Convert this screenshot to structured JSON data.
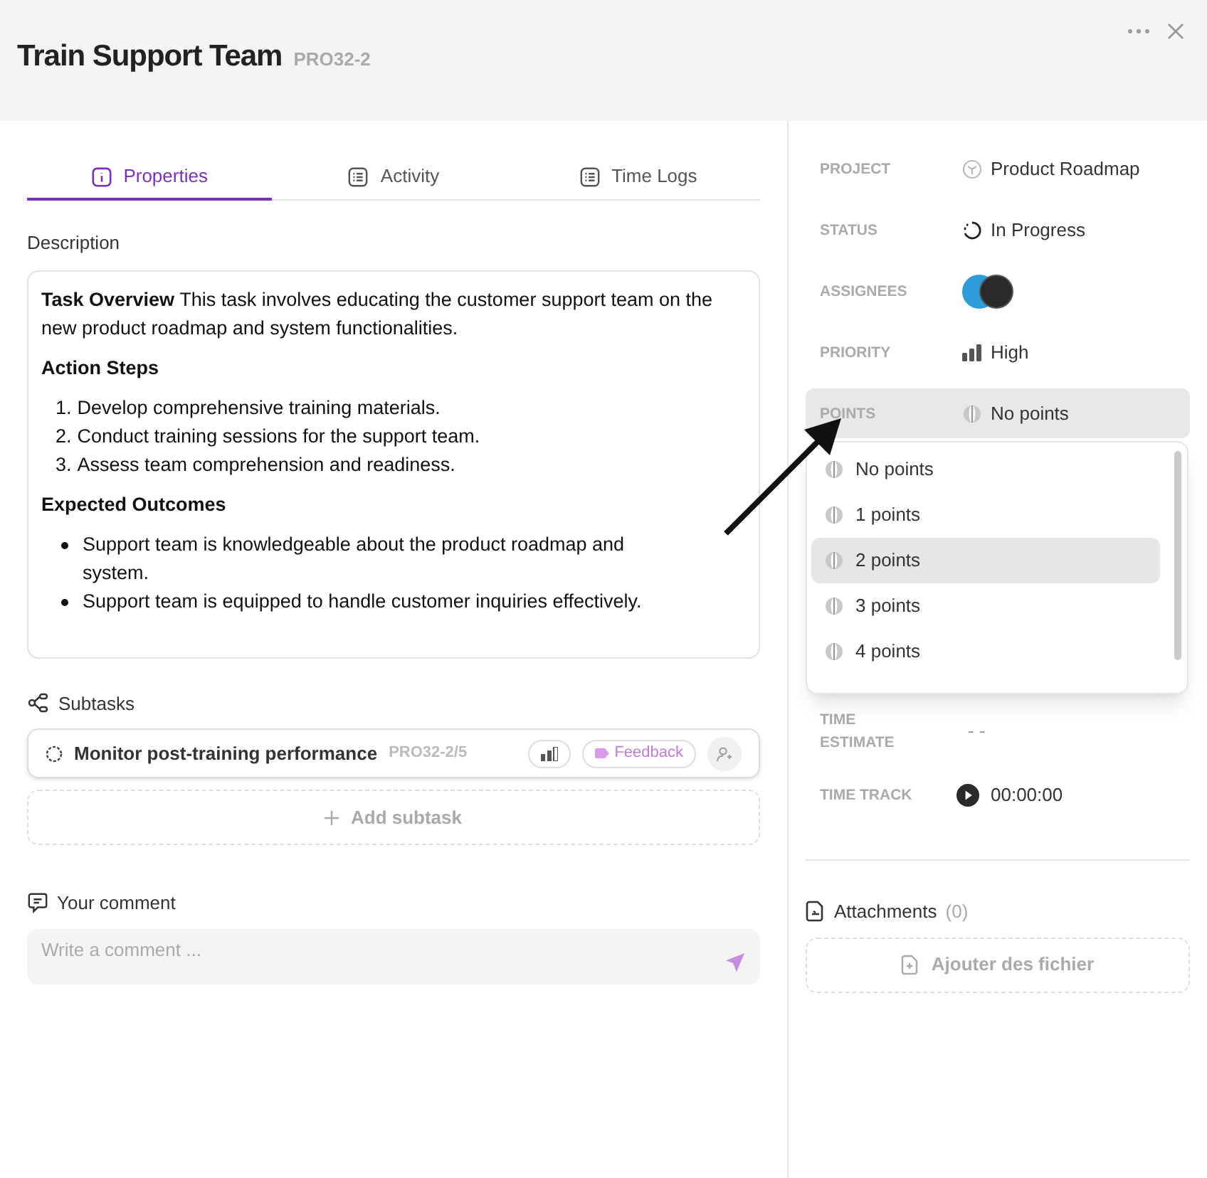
{
  "header": {
    "title": "Train Support Team",
    "code": "PRO32-2"
  },
  "tabs": [
    {
      "label": "Properties",
      "kind": "info",
      "selected": true
    },
    {
      "label": "Activity",
      "kind": "list",
      "selected": false
    },
    {
      "label": "Time Logs",
      "kind": "list",
      "selected": false
    }
  ],
  "description": {
    "label": "Description",
    "blocks": [
      {
        "kind": "paragraph",
        "text": "**Task Overview** This task involves educating the customer support team on the new product roadmap and system functionalities."
      },
      {
        "kind": "heading",
        "text": "Action Steps"
      },
      {
        "kind": "ordered_list",
        "items": [
          {
            "marker": "1.",
            "text": "Develop comprehensive training materials."
          },
          {
            "marker": "2.",
            "text": "Conduct training sessions for the support team."
          },
          {
            "marker": "3.",
            "text": "Assess team comprehension and readiness."
          }
        ]
      },
      {
        "kind": "heading",
        "text": "Expected Outcomes"
      },
      {
        "kind": "bullet_list",
        "items": [
          "Support team is knowledgeable about the product roadmap and system.",
          "Support team is equipped to handle customer inquiries effectively."
        ]
      }
    ]
  },
  "subtasks": {
    "label": "Subtasks",
    "items": [
      {
        "title": "Monitor post-training performance",
        "code": "PRO32-2/5",
        "tag": "Feedback"
      }
    ],
    "add_button": "Add subtask"
  },
  "comment": {
    "label": "Your comment",
    "placeholder": "Write a comment ..."
  },
  "fields": [
    {
      "label": "PROJECT",
      "kind": "project",
      "value": "Product Roadmap",
      "active": false
    },
    {
      "label": "STATUS",
      "kind": "status",
      "value": "In Progress",
      "active": false
    },
    {
      "label": "ASSIGNEES",
      "kind": "assignees",
      "active": false
    },
    {
      "label": "PRIORITY",
      "kind": "priority",
      "value": "High",
      "active": false
    },
    {
      "label": "POINTS",
      "kind": "points",
      "value": "No points",
      "active": true
    },
    {
      "label": "TIME ESTIMATE",
      "kind": "estimate",
      "value": "- -",
      "active": false
    },
    {
      "label": "TIME TRACK",
      "kind": "timer",
      "value": "00:00:00",
      "active": false
    }
  ],
  "points_menu": {
    "options": [
      {
        "label": "No points",
        "selected": false
      },
      {
        "label": "1 points",
        "selected": false
      },
      {
        "label": "2 points",
        "selected": true
      },
      {
        "label": "3 points",
        "selected": false
      },
      {
        "label": "4 points",
        "selected": false
      }
    ]
  },
  "attachments": {
    "label": "Attachments",
    "count": "(0)",
    "add_button": "Ajouter des fichier"
  }
}
